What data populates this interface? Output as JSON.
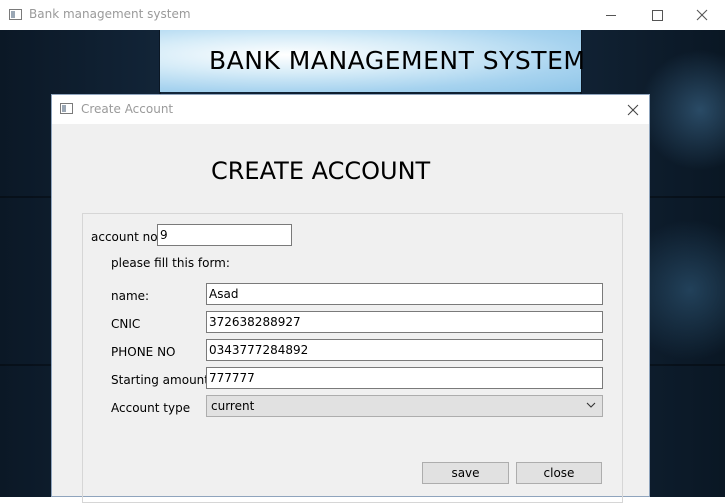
{
  "main_window": {
    "title": "Bank management system",
    "header_title": "BANK MANAGEMENT SYSTEM"
  },
  "dialog": {
    "title": "Create Account",
    "heading": "CREATE ACCOUNT",
    "account_no_label": "account no",
    "account_no_value": "9",
    "instruction": "please fill this form:",
    "fields": {
      "name": {
        "label": "name:",
        "value": "Asad"
      },
      "cnic": {
        "label": "CNIC",
        "value": "372638288927"
      },
      "phone": {
        "label": "PHONE NO",
        "value": "0343777284892"
      },
      "amount": {
        "label": "Starting amount:",
        "value": "777777"
      },
      "account_type": {
        "label": "Account type",
        "value": "current"
      }
    },
    "save_label": "save",
    "close_label": "close"
  }
}
